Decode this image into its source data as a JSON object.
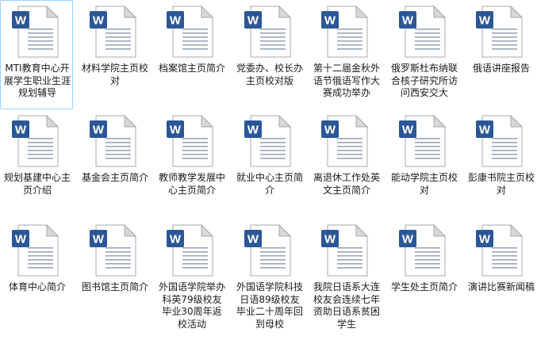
{
  "icon_colors": {
    "badge": "#2b5797",
    "badge_letter": "#ffffff",
    "page": "#ffffff",
    "page_border": "#a9a9a9",
    "lines": "#9aa6b8",
    "fold": "#d8d8d8"
  },
  "files": [
    {
      "name": "MTI教育中心开展学生职业生涯规划辅导",
      "icon": "word-document-icon",
      "selected": true
    },
    {
      "name": "材料学院主页校对",
      "icon": "word-document-icon"
    },
    {
      "name": "档案馆主页简介",
      "icon": "word-document-icon"
    },
    {
      "name": "党委办、校长办主页校对版",
      "icon": "word-document-icon"
    },
    {
      "name": "第十二届金秋外语节俄语写作大赛成功举办",
      "icon": "word-document-icon"
    },
    {
      "name": "俄罗斯杜布纳联合核子研究所访问西安交大",
      "icon": "word-document-icon"
    },
    {
      "name": "俄语讲座报告",
      "icon": "word-document-icon"
    },
    {
      "name": "规划基建中心主页介绍",
      "icon": "word-document-icon"
    },
    {
      "name": "基金会主页简介",
      "icon": "word-document-icon"
    },
    {
      "name": "教师教学发展中心主页简介",
      "icon": "word-document-icon"
    },
    {
      "name": "就业中心主页简介",
      "icon": "word-document-icon"
    },
    {
      "name": "离退休工作处英文主页简介",
      "icon": "word-document-icon"
    },
    {
      "name": "能动学院主页校对",
      "icon": "word-document-icon"
    },
    {
      "name": "彭康书院主页校对",
      "icon": "word-document-icon"
    },
    {
      "name": "体育中心简介",
      "icon": "word-document-icon"
    },
    {
      "name": "图书馆主页简介",
      "icon": "word-document-icon"
    },
    {
      "name": "外国语学院举办科英79级校友毕业30周年返校活动",
      "icon": "word-document-icon"
    },
    {
      "name": "外国语学院科技日语89级校友毕业二十周年回到母校",
      "icon": "word-document-icon"
    },
    {
      "name": "我院日语系大连校友会连续七年资助日语系贫困学生",
      "icon": "word-document-icon"
    },
    {
      "name": "学生处主页简介",
      "icon": "word-document-icon"
    },
    {
      "name": "演讲比赛新闻稿",
      "icon": "word-document-icon"
    }
  ]
}
